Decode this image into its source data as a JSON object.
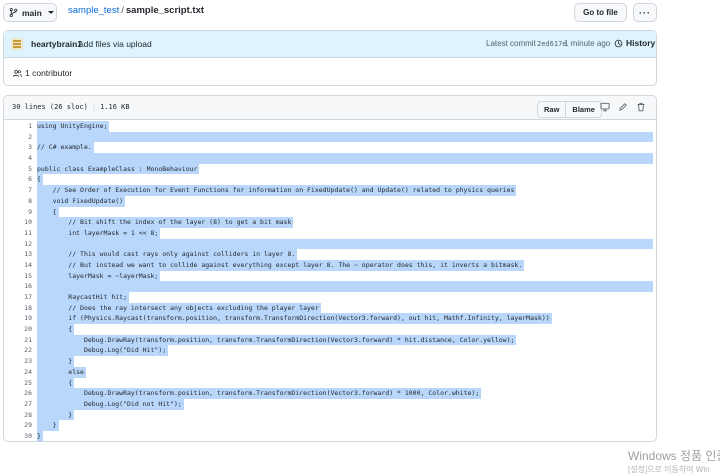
{
  "header": {
    "branch": "main",
    "repo": "sample_test",
    "separator": "/",
    "file": "sample_script.txt",
    "goto_label": "Go to file",
    "more_label": "···"
  },
  "commit": {
    "author": "heartybrain1",
    "message": "Add files via upload",
    "latest_label": "Latest commit",
    "sha": "2ed617e",
    "time": "1 minute ago",
    "history_label": "History"
  },
  "contributors": {
    "label": "1 contributor"
  },
  "file": {
    "lines_info": "30 lines (26 sloc)",
    "size": "1.16 KB",
    "raw_label": "Raw",
    "blame_label": "Blame"
  },
  "code": [
    {
      "n": "1",
      "text": "using UnityEngine;"
    },
    {
      "n": "2",
      "text": ""
    },
    {
      "n": "3",
      "text": "// C# example."
    },
    {
      "n": "4",
      "text": ""
    },
    {
      "n": "5",
      "text": "public class ExampleClass : MonoBehaviour"
    },
    {
      "n": "6",
      "text": "{"
    },
    {
      "n": "7",
      "text": "    // See Order of Execution for Event Functions for information on FixedUpdate() and Update() related to physics queries"
    },
    {
      "n": "8",
      "text": "    void FixedUpdate()"
    },
    {
      "n": "9",
      "text": "    {"
    },
    {
      "n": "10",
      "text": "        // Bit shift the index of the layer (8) to get a bit mask"
    },
    {
      "n": "11",
      "text": "        int layerMask = 1 << 8;"
    },
    {
      "n": "12",
      "text": ""
    },
    {
      "n": "13",
      "text": "        // This would cast rays only against colliders in layer 8."
    },
    {
      "n": "14",
      "text": "        // But instead we want to collide against everything except layer 8. The ~ operator does this, it inverts a bitmask."
    },
    {
      "n": "15",
      "text": "        layerMask = ~layerMask;"
    },
    {
      "n": "16",
      "text": ""
    },
    {
      "n": "17",
      "text": "        RaycastHit hit;"
    },
    {
      "n": "18",
      "text": "        // Does the ray intersect any objects excluding the player layer"
    },
    {
      "n": "19",
      "text": "        if (Physics.Raycast(transform.position, transform.TransformDirection(Vector3.forward), out hit, Mathf.Infinity, layerMask))"
    },
    {
      "n": "20",
      "text": "        {"
    },
    {
      "n": "21",
      "text": "            Debug.DrawRay(transform.position, transform.TransformDirection(Vector3.forward) * hit.distance, Color.yellow);"
    },
    {
      "n": "22",
      "text": "            Debug.Log(\"Did Hit\");"
    },
    {
      "n": "23",
      "text": "        }"
    },
    {
      "n": "24",
      "text": "        else"
    },
    {
      "n": "25",
      "text": "        {"
    },
    {
      "n": "26",
      "text": "            Debug.DrawRay(transform.position, transform.TransformDirection(Vector3.forward) * 1000, Color.white);"
    },
    {
      "n": "27",
      "text": "            Debug.Log(\"Did not Hit\");"
    },
    {
      "n": "28",
      "text": "        }"
    },
    {
      "n": "29",
      "text": "    }"
    },
    {
      "n": "30",
      "text": "}"
    }
  ],
  "watermark": {
    "line1": "Windows 정품 인증",
    "line2": "[설정]으로 이동하여 Win"
  },
  "colors": {
    "link": "#0969da",
    "commit_bg": "#ddf4ff",
    "selection": "#b9d7fb",
    "border": "#d0d7de"
  },
  "icons": [
    "git-branch-icon",
    "avatar",
    "history-icon",
    "people-icon",
    "display-icon",
    "pencil-icon",
    "trash-icon"
  ]
}
